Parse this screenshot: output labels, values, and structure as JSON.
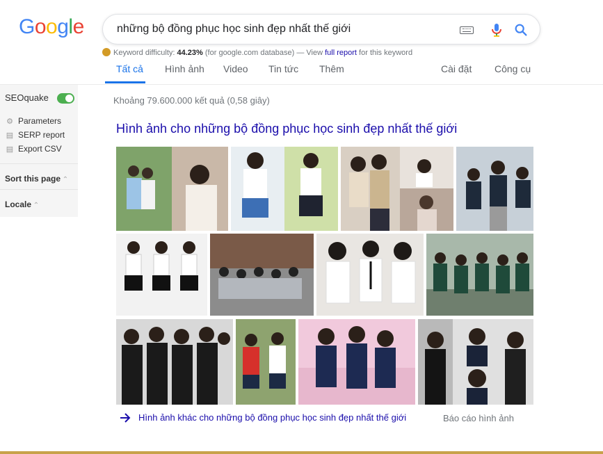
{
  "logo": {
    "letters": [
      "G",
      "o",
      "o",
      "g",
      "l",
      "e"
    ],
    "colors": [
      "#4285F4",
      "#EA4335",
      "#FBBC05",
      "#4285F4",
      "#34A853",
      "#EA4335"
    ]
  },
  "search": {
    "query": "những bộ đồng phục học sinh đẹp nhất thế giới"
  },
  "icons": {
    "keyboard": "keyboard-icon",
    "mic": "mic-icon",
    "search": "search-icon"
  },
  "seoquake_bar": {
    "label": "Keyword difficulty:",
    "value": "44.23%",
    "note": "(for google.com database) — View",
    "link": "full report",
    "tail": "for this keyword"
  },
  "tabs": [
    {
      "label": "Tất cả",
      "active": true
    },
    {
      "label": "Hình ảnh"
    },
    {
      "label": "Video"
    },
    {
      "label": "Tin tức"
    },
    {
      "label": "Thêm"
    }
  ],
  "tools": {
    "settings": "Cài đặt",
    "tools": "Công cụ"
  },
  "sidebar": {
    "title": "SEOquake",
    "toggle_on": true,
    "items": [
      {
        "label": "Parameters",
        "icon": "gear-icon"
      },
      {
        "label": "SERP report",
        "icon": "report-icon"
      },
      {
        "label": "Export CSV",
        "icon": "export-icon"
      }
    ],
    "sort_label": "Sort this page",
    "locale_label": "Locale"
  },
  "results": {
    "stats": "Khoảng 79.600.000 kết quả (0,58 giây)",
    "images_heading": "Hình ảnh cho những bộ đồng phục học sinh đẹp nhất thế giới",
    "more_images": "Hình ảnh khác cho những bộ đồng phục học sinh đẹp nhất thế giới",
    "report_images": "Báo cáo hình ảnh"
  },
  "accent": {
    "link": "#1a0dab",
    "active_tab": "#1a73e8",
    "toggle": "#4caf50"
  }
}
